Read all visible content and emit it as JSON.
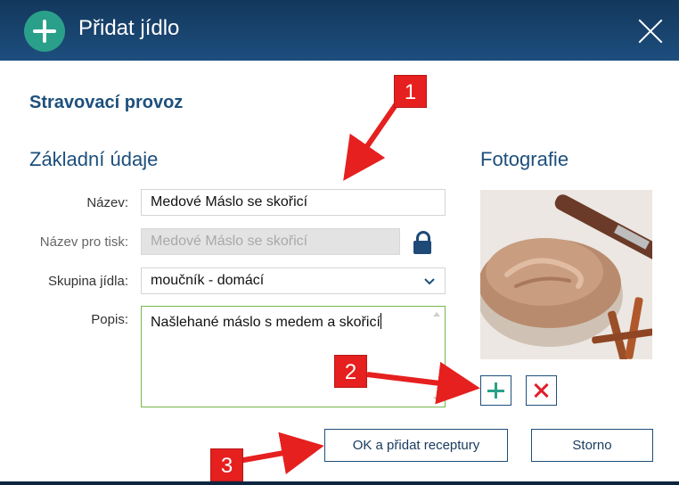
{
  "window": {
    "title": "Přidat jídlo",
    "title_icon": "plus-circle-icon",
    "close_icon": "close-icon"
  },
  "section_title": "Stravovací provoz",
  "basic": {
    "heading": "Základní údaje",
    "name_label": "Název:",
    "name_value": "Medové Máslo se skořicí",
    "print_label": "Název pro tisk:",
    "print_value": "Medové Máslo se skořicí",
    "group_label": "Skupina jídla:",
    "group_value": "moučník - domácí",
    "desc_label": "Popis:",
    "desc_value": "Našlehané máslo s medem a skořicí"
  },
  "photo": {
    "heading": "Fotografie",
    "add_icon": "plus-icon",
    "remove_icon": "x-icon"
  },
  "buttons": {
    "ok": "OK a přidat receptury",
    "cancel": "Storno"
  },
  "annotations": [
    "1",
    "2",
    "3"
  ],
  "colors": {
    "title_bar": "#1d4e7e",
    "accent_blue": "#1d4f7c",
    "add_green": "#2aa08a",
    "remove_red": "#e0202a",
    "annotation_red": "#e5201f",
    "textarea_border": "#76b84b"
  }
}
